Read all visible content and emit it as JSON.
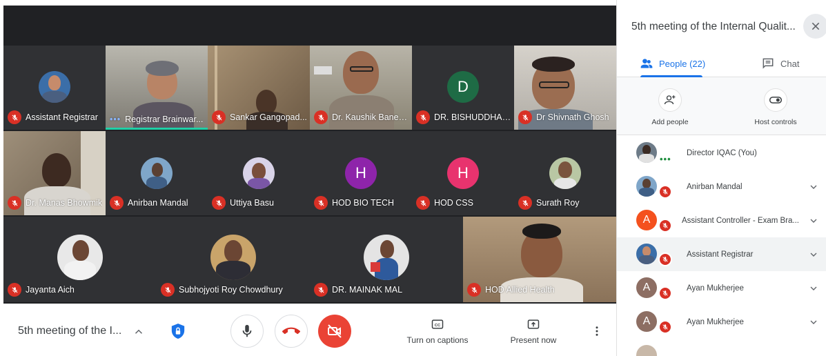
{
  "colors": {
    "muted_red": "#d93025",
    "accent_blue": "#1a73e8",
    "speaking_teal": "#1ed0a7",
    "stage_bg": "#202124",
    "avatar_green": "#1e6b45",
    "avatar_purple": "#8e24aa",
    "avatar_pink": "#e8336e",
    "avatar_orange": "#f4511e",
    "avatar_brown": "#8d6e63"
  },
  "tiles": [
    {
      "name": "Assistant Registrar",
      "type": "avatar-photo",
      "muted": true
    },
    {
      "name": "Registrar Brainwar...",
      "type": "video",
      "muted": false,
      "speaking": true
    },
    {
      "name": "Sankar Gangopad...",
      "type": "video",
      "muted": true
    },
    {
      "name": "Dr. Kaushik Banerj...",
      "type": "video",
      "muted": true
    },
    {
      "name": "DR. BISHUDDHAN...",
      "type": "avatar-letter",
      "letter": "D",
      "muted": true
    },
    {
      "name": "Dr Shivnath Ghosh",
      "type": "video",
      "muted": true
    },
    {
      "name": "Dr. Manas Bhowmik",
      "type": "video",
      "muted": true
    },
    {
      "name": "Anirban Mandal",
      "type": "avatar-photo",
      "muted": true
    },
    {
      "name": "Uttiya Basu",
      "type": "avatar-photo",
      "muted": true
    },
    {
      "name": "HOD BIO TECH",
      "type": "avatar-letter",
      "letter": "H",
      "muted": true
    },
    {
      "name": "HOD CSS",
      "type": "avatar-letter",
      "letter": "H",
      "muted": true
    },
    {
      "name": "Surath Roy",
      "type": "avatar-photo",
      "muted": true
    },
    {
      "name": "Jayanta Aich",
      "type": "avatar-photo",
      "muted": true
    },
    {
      "name": "Subhojyoti Roy Chowdhury",
      "type": "avatar-photo",
      "muted": true
    },
    {
      "name": "DR. MAINAK MAL",
      "type": "avatar-photo",
      "muted": true
    },
    {
      "name": "HOD Allied Health",
      "type": "video",
      "muted": true
    }
  ],
  "controls": {
    "meeting_name": "5th meeting of the I...",
    "captions_label": "Turn on captions",
    "present_label": "Present now"
  },
  "panel": {
    "title": "5th meeting of the Internal Qualit...",
    "people_tab": "People (22)",
    "chat_tab": "Chat",
    "add_people": "Add people",
    "host_controls": "Host controls",
    "participants": [
      {
        "name": "Director IQAC (You)",
        "avatar": "photo",
        "muted": false,
        "speaking": true
      },
      {
        "name": "Anirban Mandal",
        "avatar": "photo",
        "muted": true
      },
      {
        "name": "Assistant Controller - Exam Bra...",
        "avatar": "letter",
        "letter": "A",
        "muted": true
      },
      {
        "name": "Assistant Registrar",
        "avatar": "photo",
        "muted": true
      },
      {
        "name": "Ayan Mukherjee",
        "avatar": "letter",
        "letter": "A",
        "muted": true
      },
      {
        "name": "Ayan Mukherjee",
        "avatar": "letter",
        "letter": "A",
        "muted": true
      }
    ]
  }
}
